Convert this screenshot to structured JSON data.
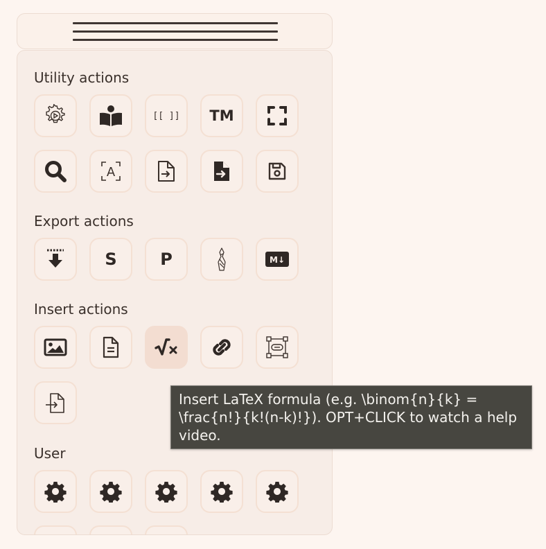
{
  "sections": {
    "utility": {
      "title": "Utility actions",
      "buttons": [
        {
          "icon": "gear-play-icon"
        },
        {
          "icon": "book-reader-icon"
        },
        {
          "icon": "brackets-icon",
          "label": "[[ ]]"
        },
        {
          "icon": "trademark-icon",
          "label": "TM"
        },
        {
          "icon": "fullscreen-icon"
        },
        {
          "icon": "search-icon"
        },
        {
          "icon": "ocr-text-icon",
          "label": "A"
        },
        {
          "icon": "file-import-icon"
        },
        {
          "icon": "file-export-icon"
        },
        {
          "icon": "save-icon"
        }
      ]
    },
    "export": {
      "title": "Export actions",
      "buttons": [
        {
          "icon": "download-icon"
        },
        {
          "icon": "svg-export-icon",
          "label": "S"
        },
        {
          "icon": "png-export-icon",
          "label": "P"
        },
        {
          "icon": "excalidraw-export-icon"
        },
        {
          "icon": "markdown-icon",
          "label": "M↓"
        }
      ]
    },
    "insert": {
      "title": "Insert actions",
      "buttons": [
        {
          "icon": "image-icon"
        },
        {
          "icon": "document-icon"
        },
        {
          "icon": "latex-formula-icon",
          "label": "√x"
        },
        {
          "icon": "link-icon"
        },
        {
          "icon": "embed-icon"
        },
        {
          "icon": "insert-file-icon"
        }
      ]
    },
    "user": {
      "title": "User",
      "buttons": [
        {
          "icon": "gear-icon"
        },
        {
          "icon": "gear-icon"
        },
        {
          "icon": "gear-icon"
        },
        {
          "icon": "gear-icon"
        },
        {
          "icon": "gear-icon"
        }
      ]
    }
  },
  "tooltip": {
    "text": "Insert LaTeX formula (e.g. \\binom{n}{k} =\n\\frac{n!}{k!(n-k)!}). OPT+CLICK to watch a help\nvideo."
  },
  "colors": {
    "background": "#fdf5f0",
    "panel": "#f7ede7",
    "button_border": "#f4e0d3",
    "icon": "#2f2825",
    "tooltip_bg": "#474640",
    "active_button": "#f3ddd1"
  }
}
